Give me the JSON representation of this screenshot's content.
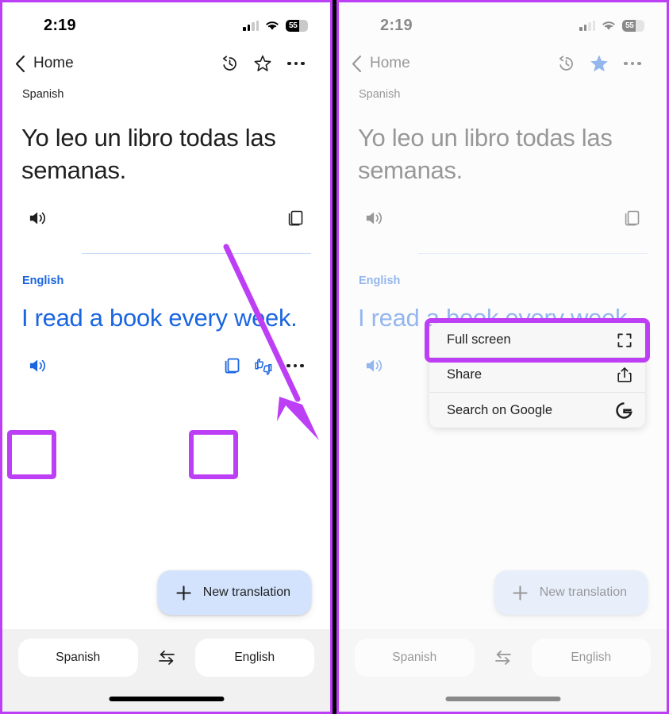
{
  "annotations": {
    "highlight_color": "#bd3ff5",
    "arrow_color": "#bd3ff5",
    "left_panel_highlights": [
      "listen-button",
      "copy-button"
    ],
    "right_panel_highlights": [
      "menu-item-full-screen"
    ]
  },
  "status_bar": {
    "time": "2:19",
    "signal_icon": "signal-bars-icon",
    "wifi_icon": "wifi-icon",
    "battery_level": "55",
    "battery_icon": "battery-icon"
  },
  "app_bar": {
    "back_icon": "chevron-left-icon",
    "back_label": "Home",
    "history_icon": "history-icon",
    "star_icon": "star-outline-icon",
    "star_icon_active": "star-filled-icon",
    "star_active_color": "#1a65e0",
    "overflow_icon": "more-horizontal-icon"
  },
  "translation": {
    "source_language": "Spanish",
    "source_text": "Yo leo un libro todas las semanas.",
    "target_language": "English",
    "target_text": "I read a book every week.",
    "target_color": "#1a65e0",
    "source_actions": {
      "listen_icon": "volume-up-icon",
      "copy_icon": "copy-icon"
    },
    "target_actions": {
      "listen_icon": "volume-up-icon",
      "copy_icon": "copy-icon",
      "feedback_icon": "thumbs-up-down-icon",
      "more_icon": "more-horizontal-icon"
    }
  },
  "fab": {
    "plus_icon": "plus-icon",
    "label": "New translation",
    "background": "#d3e3fd"
  },
  "language_bar": {
    "source": "Spanish",
    "swap_icon": "swap-horizontal-icon",
    "target": "English"
  },
  "overflow_menu": {
    "items": [
      {
        "label": "Full screen",
        "icon": "fullscreen-icon"
      },
      {
        "label": "Share",
        "icon": "share-icon"
      },
      {
        "label": "Search on Google",
        "icon": "google-g-icon"
      }
    ]
  }
}
